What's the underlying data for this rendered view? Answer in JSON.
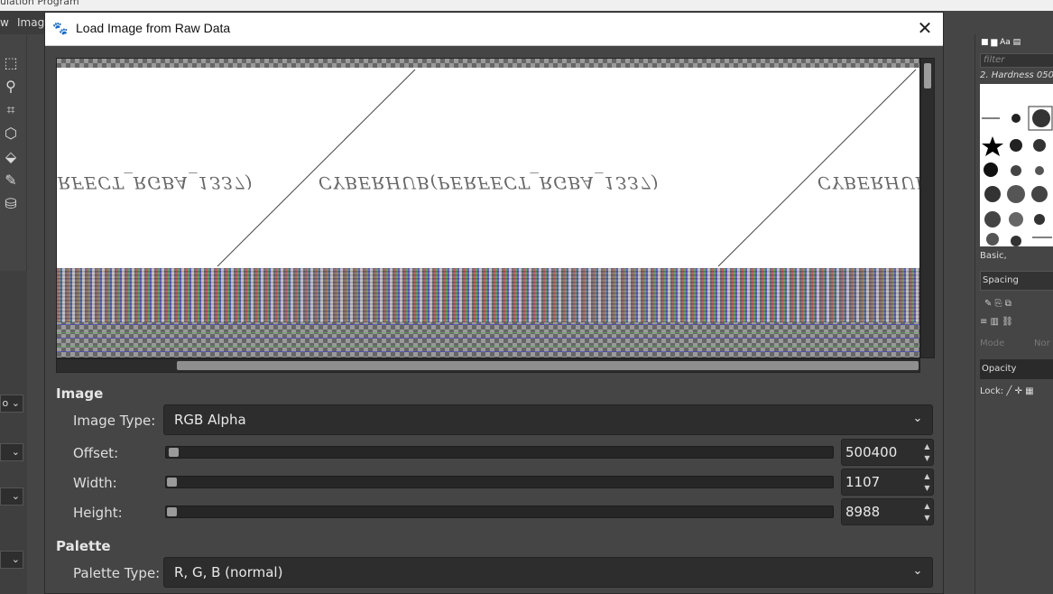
{
  "background": {
    "title_fragment": "ulation Program",
    "menu_items": [
      "w",
      "Image"
    ],
    "left_strip_controls": [
      "o ⌄",
      "⌄",
      "⌄",
      "⌄"
    ],
    "right_panel": {
      "filter_placeholder": "filter",
      "brush_name": "2. Hardness 050",
      "brush_tag": "Basic,",
      "spacing_label": "Spacing",
      "mode_label": "Mode",
      "mode_value": "Nor",
      "opacity_label": "Opacity",
      "lock_label": "Lock:"
    }
  },
  "dialog": {
    "title": "Load Image from Raw Data",
    "close_symbol": "✕",
    "preview": {
      "repeated_text": "CYBERHUB(PERFECT_RGBA_1337)"
    },
    "image_section": {
      "title": "Image",
      "image_type_label": "Image Type:",
      "image_type_value": "RGB Alpha",
      "offset_label": "Offset:",
      "offset_value": "500400",
      "width_label": "Width:",
      "width_value": "1107",
      "height_label": "Height:",
      "height_value": "8988"
    },
    "palette_section": {
      "title": "Palette",
      "palette_type_label": "Palette Type:",
      "palette_type_value": "R, G, B (normal)"
    }
  }
}
